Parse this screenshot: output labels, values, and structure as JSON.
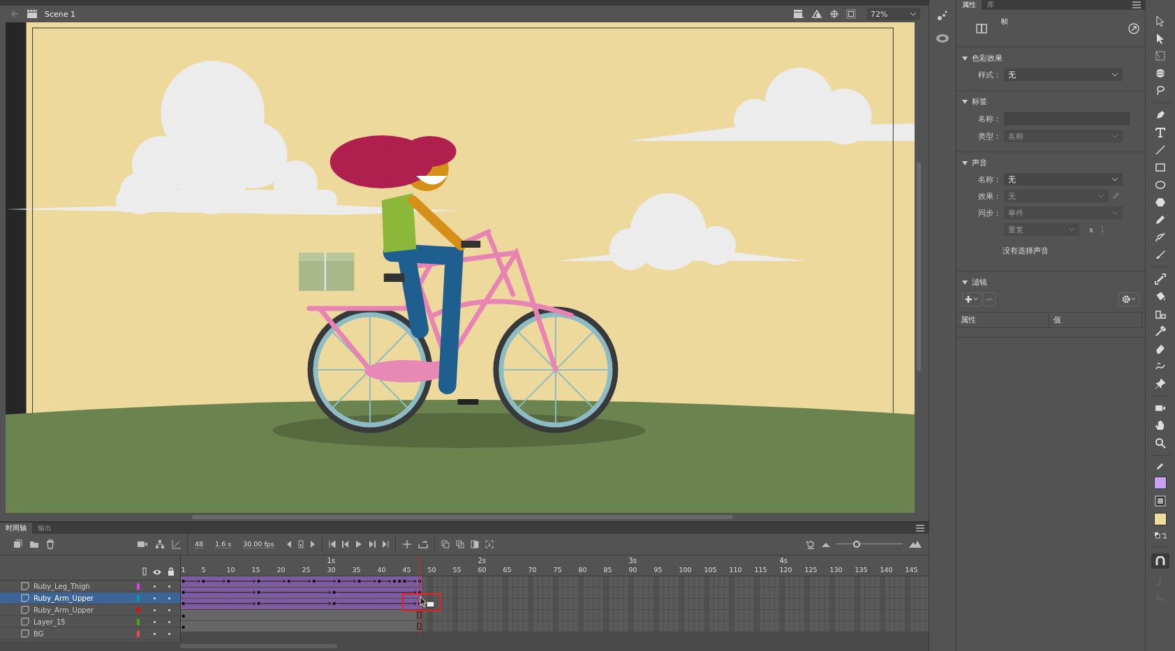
{
  "scene_bar": {
    "scene": "Scene 1",
    "zoom": "72%"
  },
  "timeline": {
    "tabs": [
      {
        "label": "时间轴",
        "selected": true
      },
      {
        "label": "输出",
        "selected": false
      }
    ],
    "current_frame": "48",
    "time": "1.6 s",
    "fps": "30.00 fps",
    "seconds": [
      "1s",
      "2s",
      "3s",
      "4s"
    ],
    "frame_numbers": [
      "1",
      "5",
      "10",
      "15",
      "20",
      "25",
      "30",
      "35",
      "40",
      "45",
      "50",
      "55",
      "60",
      "65",
      "70",
      "75",
      "80",
      "85",
      "90",
      "95",
      "100",
      "105",
      "110",
      "115",
      "120",
      "125",
      "130",
      "135",
      "140",
      "145"
    ],
    "zoom_slider": {
      "level": 0.3
    },
    "layers": [
      {
        "name": "Ruby_Leg_Thigh",
        "color": "#e040e0",
        "selected": false,
        "kind": "tween"
      },
      {
        "name": "Ruby_Arm_Upper",
        "color": "#00a0a0",
        "selected": true,
        "kind": "tween"
      },
      {
        "name": "Ruby_Arm_Upper",
        "color": "#e01010",
        "selected": false,
        "kind": "tween"
      },
      {
        "name": "Layer_15",
        "color": "#50a010",
        "selected": false,
        "kind": "static"
      },
      {
        "name": "BG",
        "color": "#e05050",
        "selected": false,
        "kind": "static"
      }
    ]
  },
  "properties": {
    "tabs": [
      {
        "label": "属性",
        "selected": true
      },
      {
        "label": "库",
        "selected": false
      }
    ],
    "header": "帧",
    "sections": [
      {
        "title": "色彩效果",
        "expanded": true,
        "rows": [
          {
            "kind": "select",
            "label": "样式：",
            "value": "无",
            "disabled": false
          }
        ]
      },
      {
        "title": "标签",
        "expanded": true,
        "rows": [
          {
            "kind": "input",
            "label": "名称：",
            "disabled": false
          },
          {
            "kind": "select",
            "label": "类型：",
            "value": "名称",
            "disabled": true
          }
        ]
      },
      {
        "title": "声音",
        "expanded": true,
        "rows": [
          {
            "kind": "select",
            "label": "名称：",
            "value": "无",
            "disabled": false
          },
          {
            "kind": "edit",
            "label": "效果：",
            "value": "无",
            "disabled": true
          },
          {
            "kind": "select",
            "label": "同步：",
            "value": "事件",
            "disabled": true
          },
          {
            "kind": "repeat",
            "value": "重复",
            "times": "x",
            "count": "1",
            "disabled": true
          },
          {
            "kind": "note",
            "text": "没有选择声音"
          }
        ]
      },
      {
        "title": "滤镜",
        "expanded": true,
        "rows": [
          {
            "kind": "filters",
            "columns": [
              "属性",
              "值"
            ]
          }
        ]
      }
    ]
  }
}
